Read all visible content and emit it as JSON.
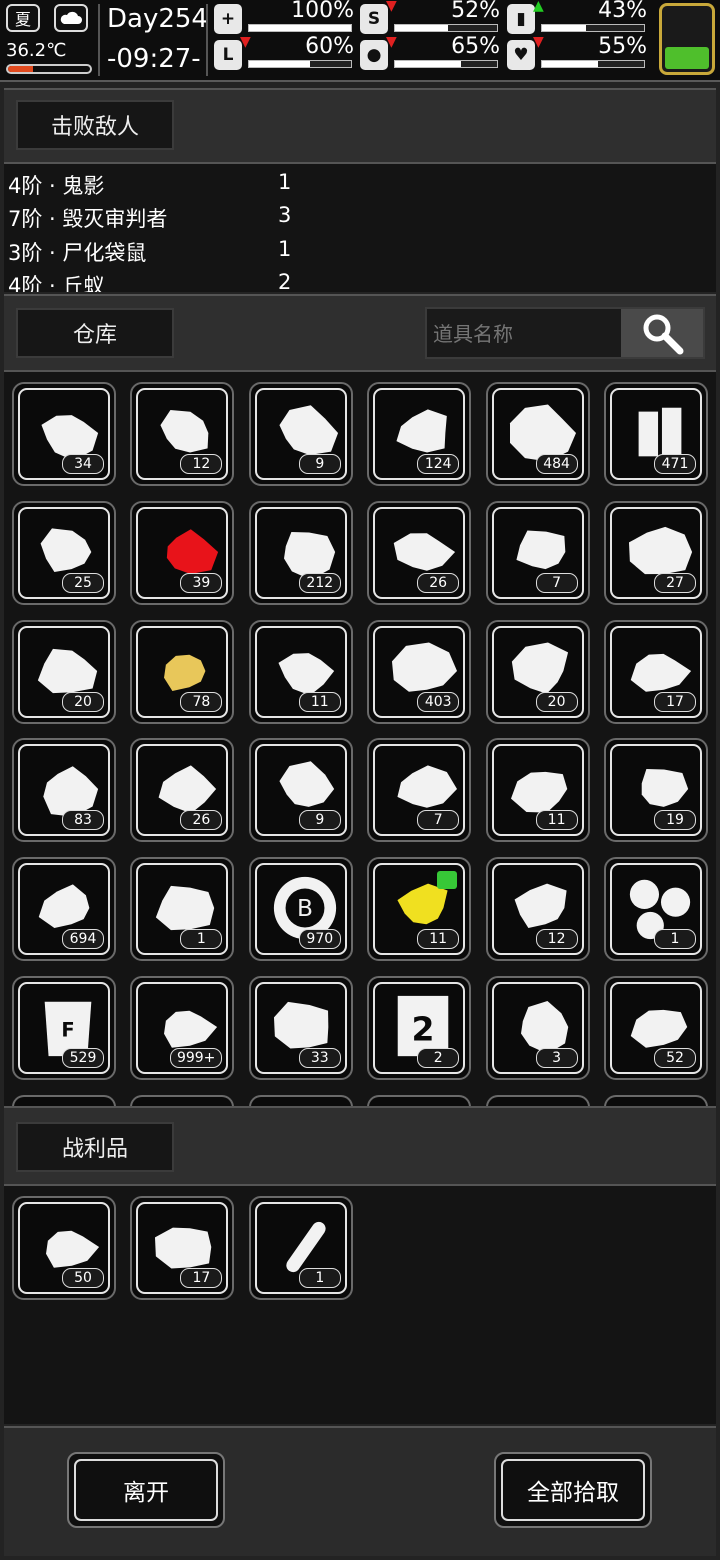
{
  "status": {
    "season": "夏",
    "weather_icon": "cloud-icon",
    "temperature": "36.2℃",
    "day": "Day254",
    "time": "-09:27-",
    "stats": [
      {
        "id": "health",
        "icon": "medkit-icon",
        "glyph": "+",
        "percent": "100%",
        "fill": 1.0,
        "arrow": ""
      },
      {
        "id": "hunger",
        "icon": "stomach-icon",
        "glyph": "S",
        "percent": "52%",
        "fill": 0.52,
        "arrow": "down",
        "arrow_color": "#e02020"
      },
      {
        "id": "energy",
        "icon": "pill-icon",
        "glyph": "▮",
        "percent": "43%",
        "fill": 0.43,
        "arrow": "up",
        "arrow_color": "#22cc22"
      },
      {
        "id": "stamina",
        "icon": "boot-icon",
        "glyph": "L",
        "percent": "60%",
        "fill": 0.6,
        "arrow": "down",
        "arrow_color": "#e02020"
      },
      {
        "id": "thirst",
        "icon": "water-drop-icon",
        "glyph": "●",
        "percent": "65%",
        "fill": 0.65,
        "arrow": "down",
        "arrow_color": "#e02020"
      },
      {
        "id": "mood",
        "icon": "heart-icon",
        "glyph": "♥",
        "percent": "55%",
        "fill": 0.55,
        "arrow": "down",
        "arrow_color": "#e02020"
      }
    ],
    "battery_fill": 0.3,
    "battery_color": "#4fbf2c"
  },
  "defeated": {
    "tab_label": "击败敌人",
    "rows": [
      {
        "name": "4阶 · 鬼影",
        "count": "1"
      },
      {
        "name": "7阶 · 毁灭审判者",
        "count": "3"
      },
      {
        "name": "3阶 · 尸化袋鼠",
        "count": "1"
      },
      {
        "name": "4阶 · 丘蚁",
        "count": "2"
      }
    ]
  },
  "warehouse": {
    "tab_label": "仓库",
    "search_placeholder": "道具名称",
    "items": [
      {
        "icon": "meat-icon",
        "qty": "34"
      },
      {
        "icon": "lemon-icon",
        "qty": "12"
      },
      {
        "icon": "ginger-icon",
        "qty": "9"
      },
      {
        "icon": "fiber-pile-icon",
        "qty": "124"
      },
      {
        "icon": "soil-sprout-icon",
        "qty": "484"
      },
      {
        "icon": "battery-icon",
        "qty": "471"
      },
      {
        "icon": "seeds-icon",
        "qty": "25"
      },
      {
        "icon": "red-herb-icon",
        "qty": "39",
        "color": "#e8131a"
      },
      {
        "icon": "ice-block-icon",
        "qty": "212"
      },
      {
        "icon": "berry-branch-icon",
        "qty": "26"
      },
      {
        "icon": "root-icon",
        "qty": "7"
      },
      {
        "icon": "mint-leaf-icon",
        "qty": "27"
      },
      {
        "icon": "rice-grains-icon",
        "qty": "20"
      },
      {
        "icon": "yellow-herb-icon",
        "qty": "78",
        "color": "#e8c75a"
      },
      {
        "icon": "sunflower-seeds-icon",
        "qty": "11"
      },
      {
        "icon": "pepper-seeds-icon",
        "qty": "403"
      },
      {
        "icon": "spinach-icon",
        "qty": "20"
      },
      {
        "icon": "lime-slice-icon",
        "qty": "17"
      },
      {
        "icon": "weed-plant-icon",
        "qty": "83"
      },
      {
        "icon": "flower-icon",
        "qty": "26"
      },
      {
        "icon": "leaves-icon",
        "qty": "9"
      },
      {
        "icon": "cherries-icon",
        "qty": "7"
      },
      {
        "icon": "fur-sack-icon",
        "qty": "11"
      },
      {
        "icon": "pelt-icon",
        "qty": "19"
      },
      {
        "icon": "tools-kit-icon",
        "qty": "694"
      },
      {
        "icon": "bottles-icon",
        "qty": "1"
      },
      {
        "icon": "bitcoin-chip-icon",
        "qty": "970"
      },
      {
        "icon": "yellow-cubes-icon",
        "qty": "11",
        "color": "#f0e020",
        "badge": true
      },
      {
        "icon": "beans-icon",
        "qty": "12"
      },
      {
        "icon": "screw-heads-icon",
        "qty": "1"
      },
      {
        "icon": "fertilizer-bag-icon",
        "qty": "529"
      },
      {
        "icon": "cloth-icon",
        "qty": "999+"
      },
      {
        "icon": "metal-ingots-icon",
        "qty": "33"
      },
      {
        "icon": "level-card-icon",
        "qty": "2"
      },
      {
        "icon": "strawberry-icon",
        "qty": "3"
      },
      {
        "icon": "paper-roll-icon",
        "qty": "52"
      }
    ]
  },
  "loot": {
    "tab_label": "战利品",
    "items": [
      {
        "icon": "cloth-icon",
        "qty": "50"
      },
      {
        "icon": "raw-meat-icon",
        "qty": "17"
      },
      {
        "icon": "test-tube-icon",
        "qty": "1"
      }
    ]
  },
  "buttons": {
    "leave": "离开",
    "take_all": "全部拾取"
  }
}
